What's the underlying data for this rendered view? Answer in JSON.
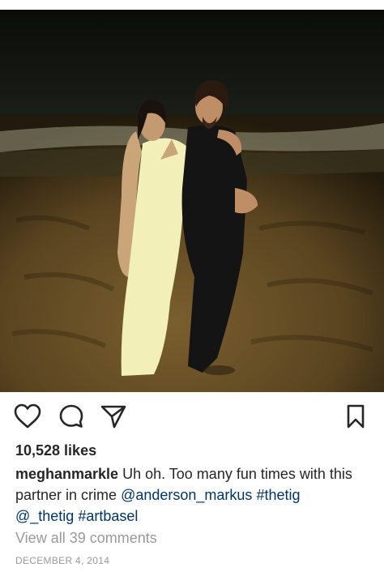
{
  "post": {
    "likes": "10,528 likes",
    "username": "meghanmarkle",
    "caption_text": "Uh oh. Too many fun times with this partner in crime",
    "mention_1": "@anderson_markus",
    "hashtag_1": "#thetig",
    "mention_2": "@_thetig",
    "hashtag_2": "#artbasel",
    "view_comments": "View all 39 comments",
    "date": "DECEMBER 4, 2014"
  },
  "actions": {
    "like_icon": "heart-icon",
    "comment_icon": "comment-icon",
    "share_icon": "send-icon",
    "save_icon": "bookmark-icon"
  },
  "colors": {
    "text": "#262626",
    "link": "#003569",
    "muted": "#999999"
  }
}
